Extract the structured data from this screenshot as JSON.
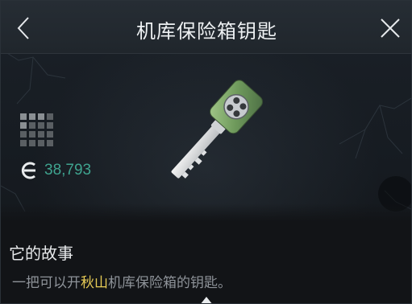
{
  "header": {
    "title": "机库保险箱钥匙",
    "back_icon": "chevron-left-icon",
    "close_icon": "close-icon"
  },
  "item": {
    "icon": "safe-key-icon",
    "rarity_level": 5,
    "rarity_max": 16,
    "currency_icon": "currency-icon",
    "value": "38,793",
    "value_color": "#3fa48f"
  },
  "story": {
    "title": "它的故事",
    "text_before": "一把可以开",
    "text_highlight": "秋山",
    "text_after": "机库保险箱的钥匙。",
    "highlight_color": "#e8cc56"
  }
}
